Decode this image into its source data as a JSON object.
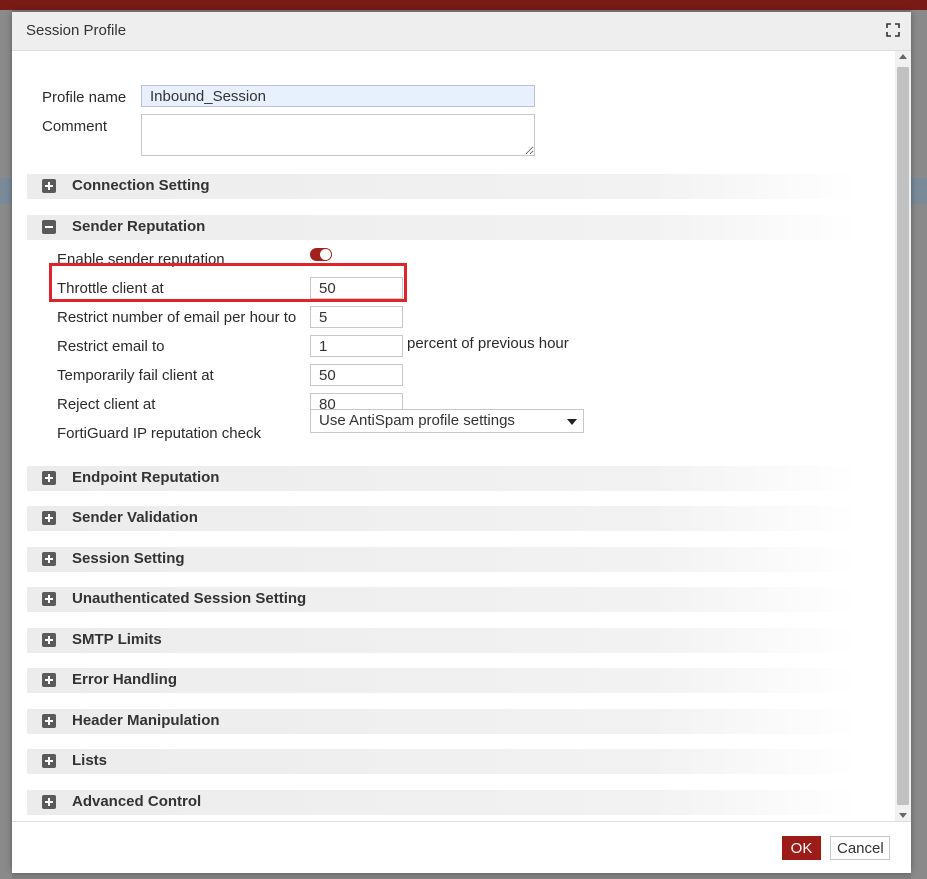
{
  "dialog": {
    "title": "Session Profile",
    "maximize_icon": "maximize-icon"
  },
  "profile": {
    "name_label": "Profile name",
    "name_value": "Inbound_Session",
    "comment_label": "Comment",
    "comment_value": ""
  },
  "sections": {
    "connection_setting": "Connection Setting",
    "sender_reputation": "Sender Reputation",
    "endpoint_reputation": "Endpoint Reputation",
    "sender_validation": "Sender Validation",
    "session_setting": "Session Setting",
    "unauthenticated_session_setting": "Unauthenticated Session Setting",
    "smtp_limits": "SMTP Limits",
    "error_handling": "Error Handling",
    "header_manipulation": "Header Manipulation",
    "lists": "Lists",
    "advanced_control": "Advanced Control"
  },
  "sender_reputation": {
    "enable_label": "Enable sender reputation",
    "enable_on": true,
    "throttle_label": "Throttle client at",
    "throttle_value": "50",
    "restrict_per_hour_label": "Restrict number of email per hour to",
    "restrict_per_hour_value": "5",
    "restrict_email_label": "Restrict email to",
    "restrict_email_value": "1",
    "restrict_email_suffix": "percent of previous hour",
    "temp_fail_label": "Temporarily fail client at",
    "temp_fail_value": "50",
    "reject_label": "Reject client at",
    "reject_value": "80",
    "fortiguard_label": "FortiGuard IP reputation check",
    "fortiguard_value": "Use AntiSpam profile settings"
  },
  "footer": {
    "ok_label": "OK",
    "cancel_label": "Cancel"
  },
  "colors": {
    "accent": "#9e1c17",
    "highlight_box": "#e0222a",
    "top_bar": "#7a1a17"
  }
}
